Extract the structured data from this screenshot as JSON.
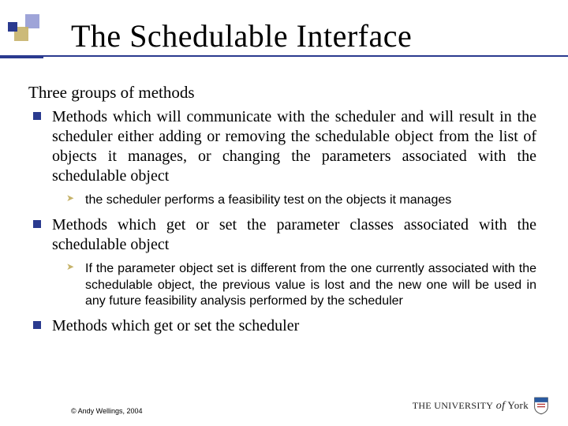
{
  "title": "The Schedulable Interface",
  "subtitle": "Three groups of methods",
  "bullets": [
    {
      "text": "Methods which will communicate with the scheduler and will result in the scheduler either adding or removing the schedulable object from the list of objects it manages, or changing the parameters associated with the schedulable object",
      "sub": [
        "the scheduler performs a feasibility test on the objects it manages"
      ]
    },
    {
      "text": "Methods which get or set the parameter classes associated with the schedulable object",
      "sub": [
        "If the parameter object set is different from the one currently associated with the schedulable object, the previous value is lost and the new one will be used in any future feasibility analysis performed by the scheduler"
      ]
    },
    {
      "text": "Methods which get or set the scheduler",
      "sub": []
    }
  ],
  "copyright": "© Andy Wellings, 2004",
  "logo": {
    "prefix": "THE UNIVERSITY",
    "of": "of",
    "name": "York"
  }
}
